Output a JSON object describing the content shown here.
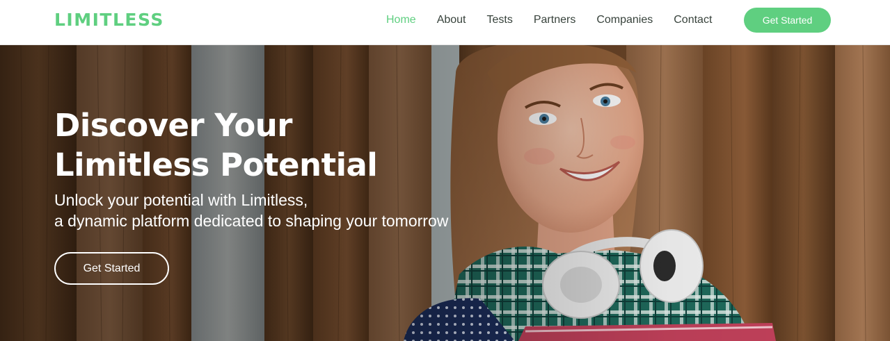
{
  "header": {
    "logo": "LIMITLESS",
    "nav": [
      {
        "label": "Home",
        "active": true
      },
      {
        "label": "About"
      },
      {
        "label": "Tests"
      },
      {
        "label": "Partners"
      },
      {
        "label": "Companies"
      },
      {
        "label": "Contact"
      }
    ],
    "cta_label": "Get Started"
  },
  "hero": {
    "title_lines": [
      "Discover Your",
      "Limitless Potential"
    ],
    "subtitle_lines": [
      "Unlock your potential with Limitless,",
      "a dynamic platform dedicated to shaping your tomorrow"
    ],
    "cta_label": "Get Started",
    "image": "student-with-headphones-photo"
  },
  "colors": {
    "accent": "#5fcf80",
    "nav_text": "#37423b",
    "hero_text": "#ffffff"
  }
}
